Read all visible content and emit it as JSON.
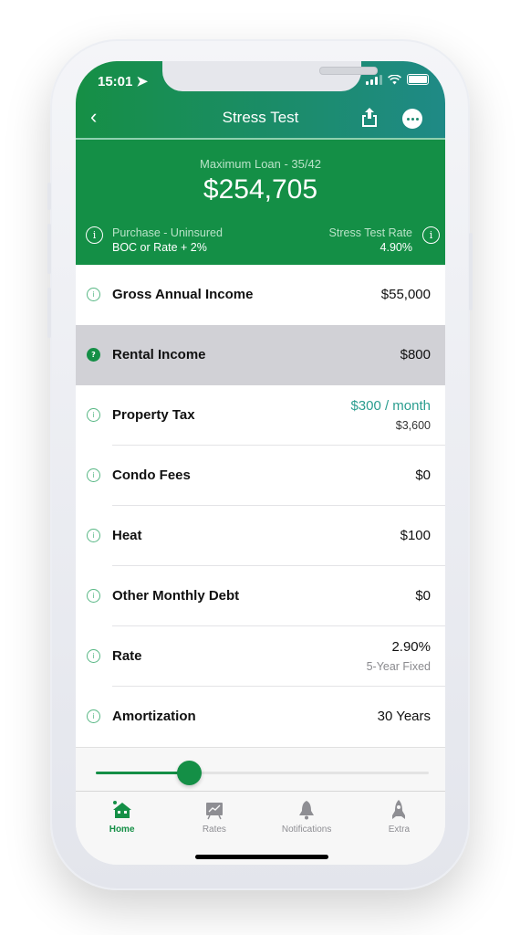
{
  "status_bar": {
    "time": "15:01"
  },
  "nav": {
    "title": "Stress Test"
  },
  "summary": {
    "label": "Maximum Loan - 35/42",
    "amount": "$254,705",
    "left_line1": "Purchase - Uninsured",
    "left_line2": "BOC or Rate + 2%",
    "right_line1": "Stress Test Rate",
    "right_line2": "4.90%"
  },
  "rows": [
    {
      "label": "Gross Annual Income",
      "value": "$55,000"
    },
    {
      "label": "Rental Income",
      "value": "$800"
    },
    {
      "label": "Property Tax",
      "value": "$300 / month",
      "sub": "$3,600"
    },
    {
      "label": "Condo Fees",
      "value": "$0"
    },
    {
      "label": "Heat",
      "value": "$100"
    },
    {
      "label": "Other Monthly Debt",
      "value": "$0"
    },
    {
      "label": "Rate",
      "value": "2.90%",
      "sub": "5-Year Fixed"
    },
    {
      "label": "Amortization",
      "value": "30 Years"
    }
  ],
  "slider": {
    "fraction": 0.28
  },
  "tabs": [
    {
      "label": "Home",
      "icon": "home-icon",
      "active": true
    },
    {
      "label": "Rates",
      "icon": "chart-board-icon"
    },
    {
      "label": "Notifications",
      "icon": "bell-icon"
    },
    {
      "label": "Extra",
      "icon": "rocket-icon"
    }
  ],
  "colors": {
    "brand_green": "#148f46",
    "accent_teal": "#2a9d8f"
  }
}
